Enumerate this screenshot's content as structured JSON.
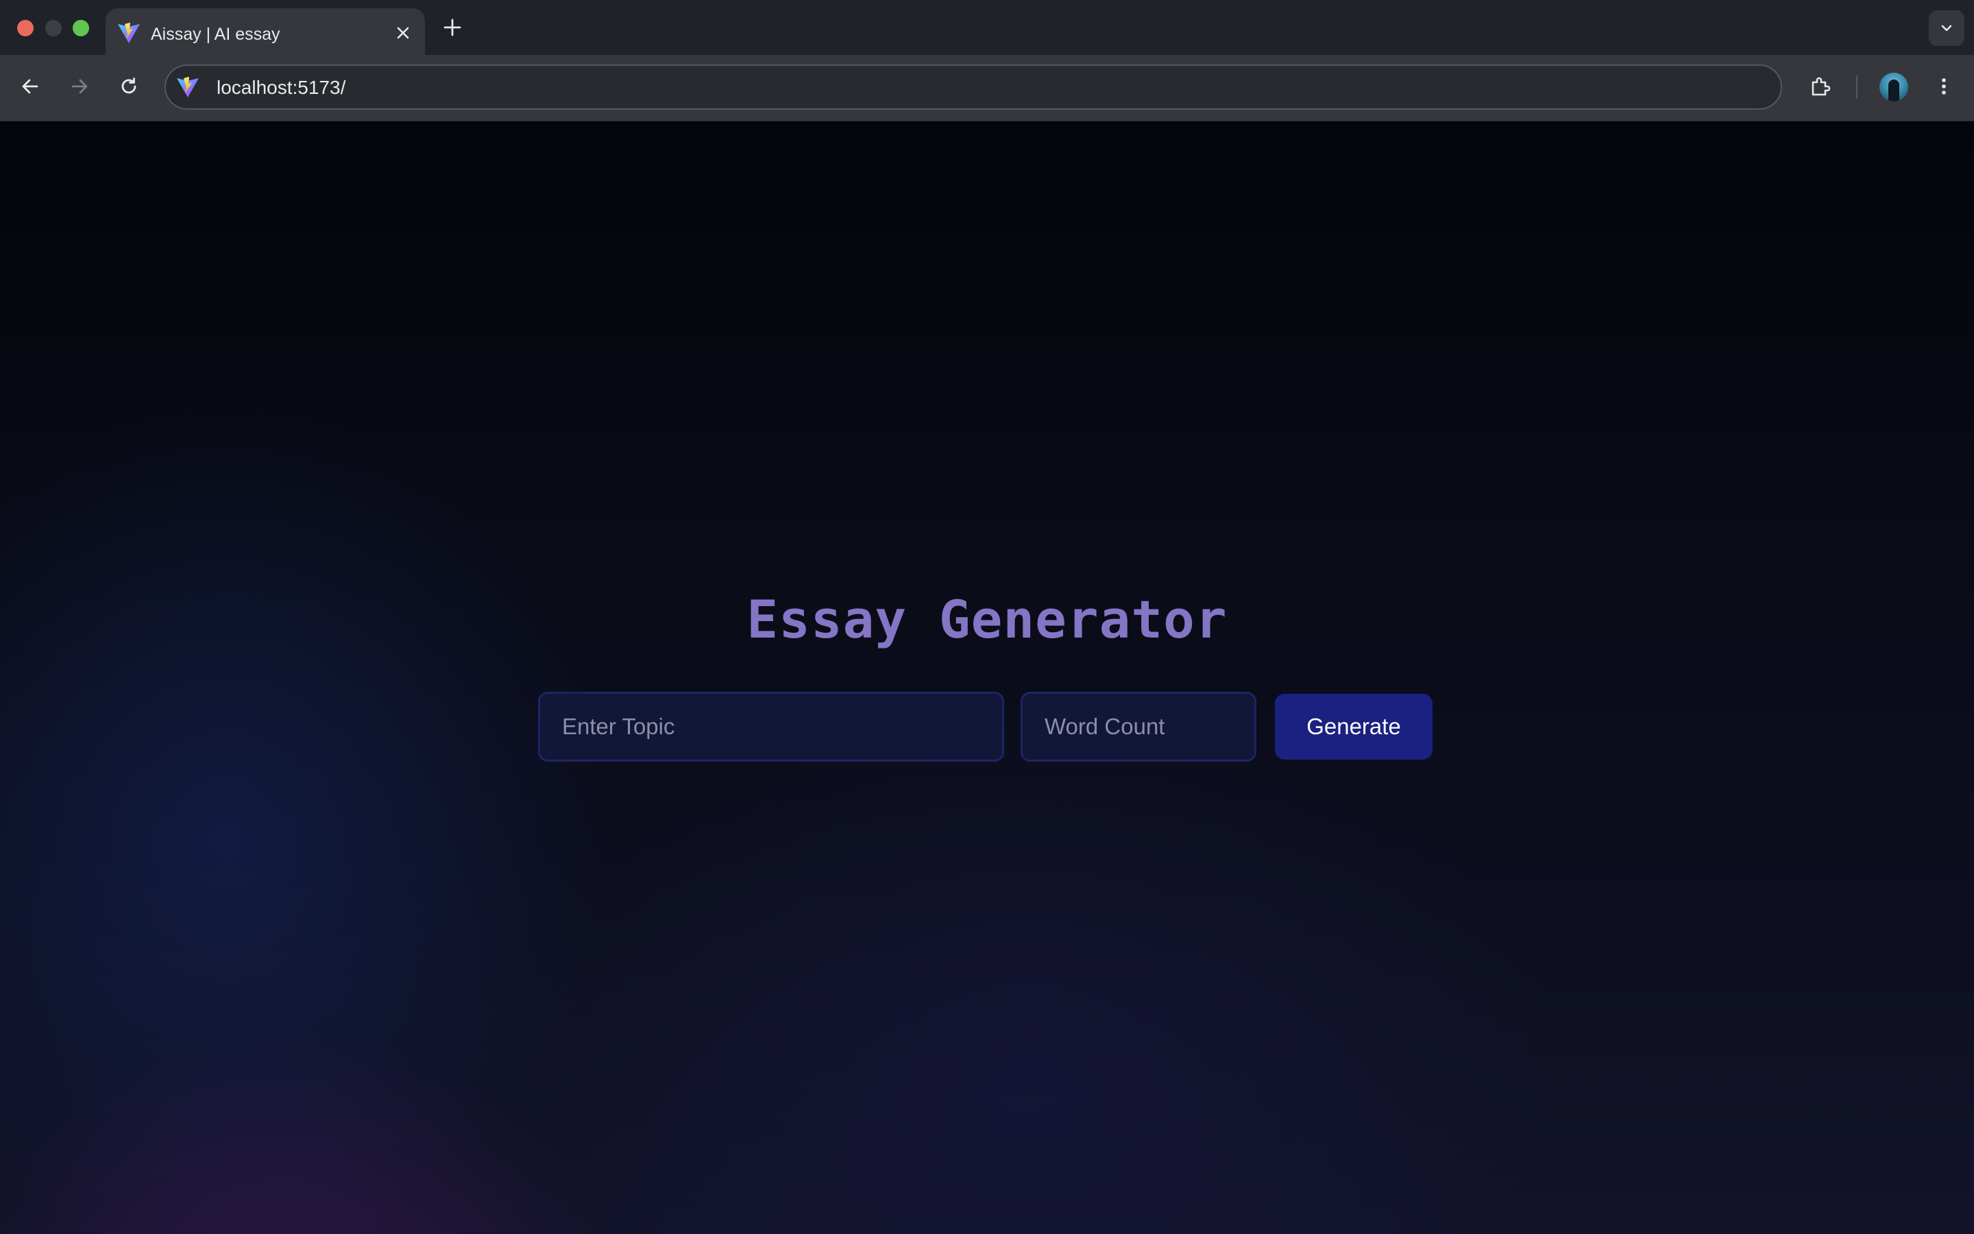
{
  "browser": {
    "tab": {
      "title": "Aissay | AI essay",
      "favicon": "vite-logo-icon"
    },
    "address_bar": {
      "url": "localhost:5173/"
    },
    "icons": {
      "close_tab": "close-icon",
      "new_tab": "plus-icon",
      "tab_search": "chevron-down-icon",
      "back": "arrow-left-icon",
      "forward": "arrow-right-icon",
      "reload": "reload-icon",
      "extensions": "puzzle-icon",
      "profile": "avatar",
      "menu": "kebab-menu-icon"
    }
  },
  "page": {
    "title": "Essay Generator",
    "topic_input": {
      "placeholder": "Enter Topic",
      "value": ""
    },
    "word_count_input": {
      "placeholder": "Word Count",
      "value": ""
    },
    "generate_button": {
      "label": "Generate"
    }
  },
  "colors": {
    "title": "#8476c5",
    "input_background": "#121637",
    "input_border": "#1d2563",
    "button_background": "#1a2180",
    "button_text": "#ffffff"
  }
}
